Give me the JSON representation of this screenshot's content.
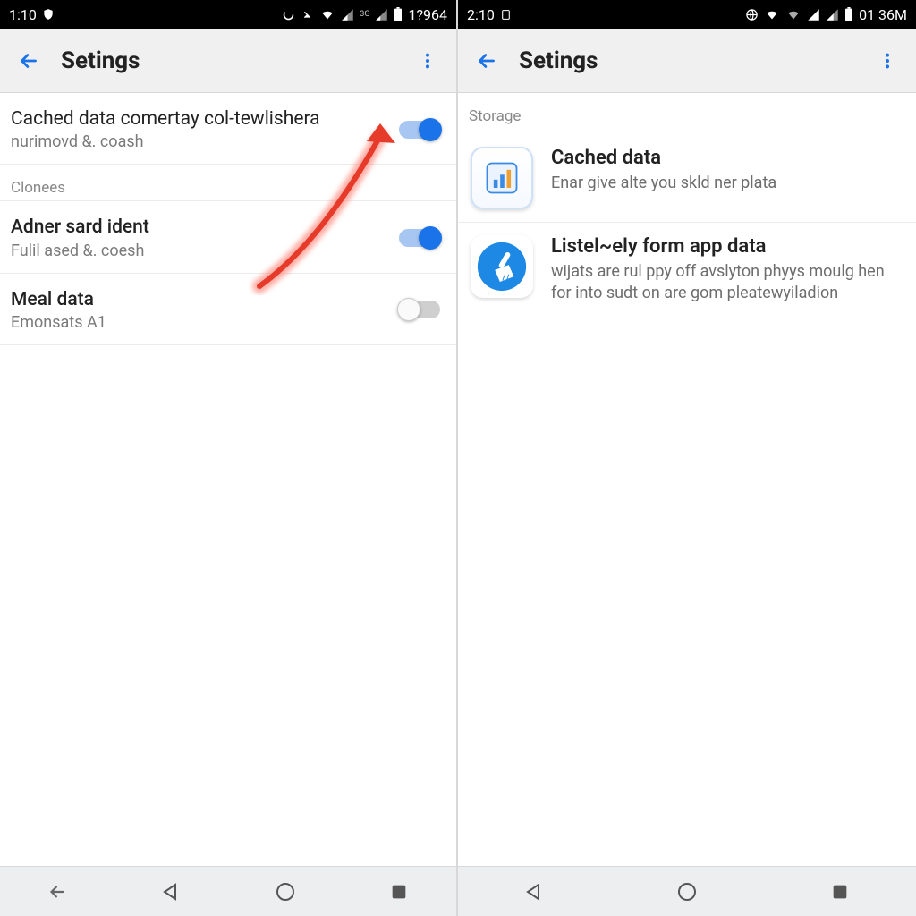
{
  "left": {
    "status": {
      "time": "1:10",
      "right_label": "1?964"
    },
    "appbar": {
      "title": "Setings"
    },
    "items": [
      {
        "title": "Cached data comertay col-tewlishera",
        "sub": "nurimovd &. coash",
        "toggle": "on"
      }
    ],
    "section": "Clonees",
    "items2": [
      {
        "title": "Adner sard ident",
        "sub": "Fulil ased &. coesh",
        "toggle": "on"
      },
      {
        "title": "Meal data",
        "sub": "Emonsats A1",
        "toggle": "off"
      }
    ]
  },
  "right": {
    "status": {
      "time": "2:10",
      "right_label": "01 36M"
    },
    "appbar": {
      "title": "Setings"
    },
    "section": "Storage",
    "items": [
      {
        "title": "Cached data",
        "sub": "Enar give alte you skld ner plata"
      },
      {
        "title": "Listel~ely form app data",
        "sub": "wijats are rul ppy off avslyton phyys moulg hen for into sudt on are gom pleatewyiladion"
      }
    ]
  }
}
